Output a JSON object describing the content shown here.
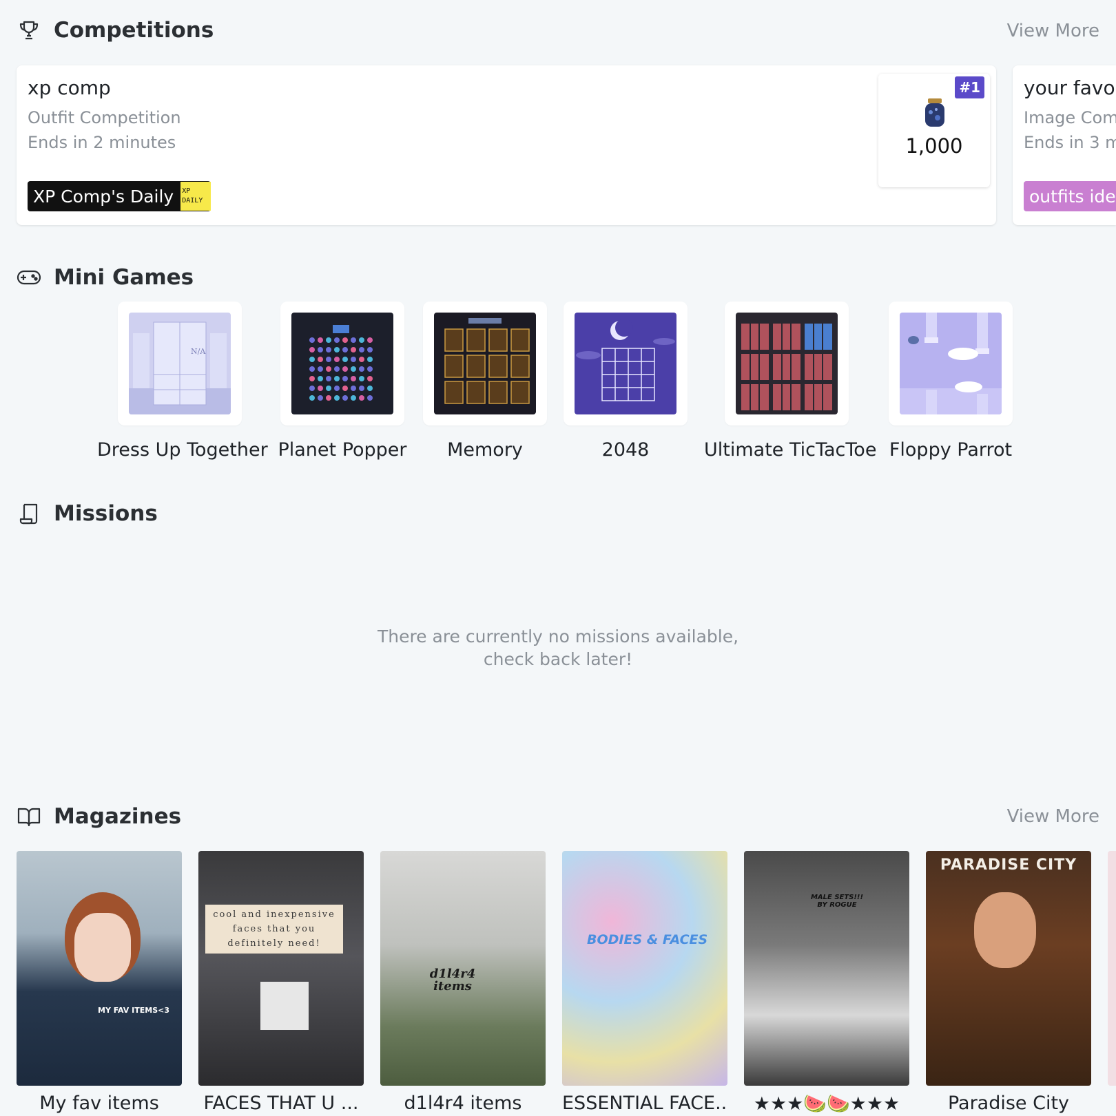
{
  "competitions": {
    "title": "Competitions",
    "icon": "trophy-icon",
    "view_more": "View More",
    "cards": [
      {
        "title": "xp comp",
        "type": "Outfit Competition",
        "ends": "Ends in 2 minutes",
        "tag": "XP Comp's Daily",
        "tag_badge": [
          "XP",
          "DAILY"
        ],
        "rank": "#1",
        "prize": "1,000"
      },
      {
        "title": "your favou",
        "type": "Image Comp",
        "ends": "Ends in 3 m",
        "tag": "outfits idea"
      }
    ]
  },
  "mini_games": {
    "title": "Mini Games",
    "icon": "gamepad-icon",
    "items": [
      {
        "label": "Dress Up Together"
      },
      {
        "label": "Planet Popper"
      },
      {
        "label": "Memory"
      },
      {
        "label": "2048"
      },
      {
        "label": "Ultimate TicTacToe"
      },
      {
        "label": "Floppy Parrot"
      }
    ]
  },
  "missions": {
    "title": "Missions",
    "icon": "scroll-icon",
    "empty_line1": "There are currently no missions available,",
    "empty_line2": "check back later!"
  },
  "magazines": {
    "title": "Magazines",
    "icon": "open-book-icon",
    "view_more": "View More",
    "items": [
      {
        "label": "My fav items",
        "cover_text": "MY FAV ITEMS<3"
      },
      {
        "label": "FACES THAT U ...",
        "cover_text": "cool and inexpensive faces that you definitely need!"
      },
      {
        "label": "d1l4r4 items",
        "cover_text": "d1l4r4 items"
      },
      {
        "label": "ESSENTIAL FACE...",
        "cover_text": "BODIES & FACES"
      },
      {
        "label": "★★★🍉🍉★★★",
        "cover_text": "MALE SETS!!! BY ROGUE"
      },
      {
        "label": "Paradise City",
        "cover_text": "PARADISE CITY"
      }
    ]
  },
  "colors": {
    "background": "#f4f7f9",
    "muted_text": "#8a9097",
    "rank_badge": "#5b4ac9",
    "pink_tag": "#c97fd1",
    "xp_badge": "#f7e94a"
  }
}
